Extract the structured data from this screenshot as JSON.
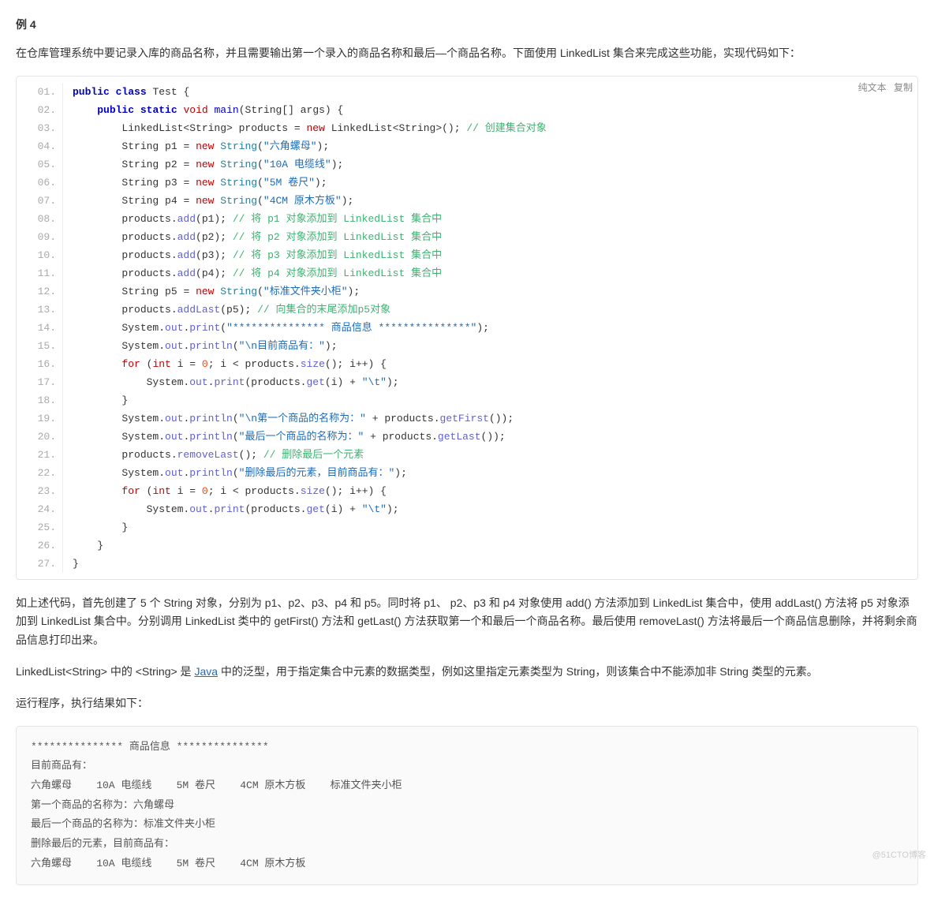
{
  "heading": "例 4",
  "intro": "在仓库管理系统中要记录入库的商品名称，并且需要输出第一个录入的商品名称和最后—个商品名称。下面使用 LinkedList 集合来完成这些功能，实现代码如下：",
  "toolbar": {
    "plain": "纯文本",
    "copy": "复制"
  },
  "code": {
    "lines": [
      [
        {
          "t": "public",
          "c": "kw"
        },
        {
          "t": " "
        },
        {
          "t": "class",
          "c": "kw"
        },
        {
          "t": " Test {"
        }
      ],
      [
        {
          "t": "    "
        },
        {
          "t": "public",
          "c": "kw"
        },
        {
          "t": " "
        },
        {
          "t": "static",
          "c": "kw"
        },
        {
          "t": " "
        },
        {
          "t": "void",
          "c": "kw2"
        },
        {
          "t": " "
        },
        {
          "t": "main",
          "c": "method"
        },
        {
          "t": "(String[] args) {"
        }
      ],
      [
        {
          "t": "        LinkedList<String> products "
        },
        {
          "t": "=",
          "c": "punct"
        },
        {
          "t": " "
        },
        {
          "t": "new",
          "c": "kw2"
        },
        {
          "t": " LinkedList<String>();"
        },
        {
          "t": " "
        },
        {
          "t": "// 创建集合对象",
          "c": "comment"
        }
      ],
      [
        {
          "t": "        String p1 "
        },
        {
          "t": "=",
          "c": "punct"
        },
        {
          "t": " "
        },
        {
          "t": "new",
          "c": "kw2"
        },
        {
          "t": " "
        },
        {
          "t": "String",
          "c": "fn"
        },
        {
          "t": "("
        },
        {
          "t": "\"六角螺母\"",
          "c": "str"
        },
        {
          "t": ");"
        }
      ],
      [
        {
          "t": "        String p2 "
        },
        {
          "t": "=",
          "c": "punct"
        },
        {
          "t": " "
        },
        {
          "t": "new",
          "c": "kw2"
        },
        {
          "t": " "
        },
        {
          "t": "String",
          "c": "fn"
        },
        {
          "t": "("
        },
        {
          "t": "\"10A 电缆线\"",
          "c": "str"
        },
        {
          "t": ");"
        }
      ],
      [
        {
          "t": "        String p3 "
        },
        {
          "t": "=",
          "c": "punct"
        },
        {
          "t": " "
        },
        {
          "t": "new",
          "c": "kw2"
        },
        {
          "t": " "
        },
        {
          "t": "String",
          "c": "fn"
        },
        {
          "t": "("
        },
        {
          "t": "\"5M 卷尺\"",
          "c": "str"
        },
        {
          "t": ");"
        }
      ],
      [
        {
          "t": "        String p4 "
        },
        {
          "t": "=",
          "c": "punct"
        },
        {
          "t": " "
        },
        {
          "t": "new",
          "c": "kw2"
        },
        {
          "t": " "
        },
        {
          "t": "String",
          "c": "fn"
        },
        {
          "t": "("
        },
        {
          "t": "\"4CM 原木方板\"",
          "c": "str"
        },
        {
          "t": ");"
        }
      ],
      [
        {
          "t": "        products."
        },
        {
          "t": "add",
          "c": "methodCall"
        },
        {
          "t": "(p1);"
        },
        {
          "t": " "
        },
        {
          "t": "// 将 p1 对象添加到 LinkedList 集合中",
          "c": "comment"
        }
      ],
      [
        {
          "t": "        products."
        },
        {
          "t": "add",
          "c": "methodCall"
        },
        {
          "t": "(p2);"
        },
        {
          "t": " "
        },
        {
          "t": "// 将 p2 对象添加到 LinkedList 集合中",
          "c": "comment"
        }
      ],
      [
        {
          "t": "        products."
        },
        {
          "t": "add",
          "c": "methodCall"
        },
        {
          "t": "(p3);"
        },
        {
          "t": " "
        },
        {
          "t": "// 将 p3 对象添加到 LinkedList 集合中",
          "c": "comment"
        }
      ],
      [
        {
          "t": "        products."
        },
        {
          "t": "add",
          "c": "methodCall"
        },
        {
          "t": "(p4);"
        },
        {
          "t": " "
        },
        {
          "t": "// 将 p4 对象添加到 LinkedList 集合中",
          "c": "comment"
        }
      ],
      [
        {
          "t": "        String p5 "
        },
        {
          "t": "=",
          "c": "punct"
        },
        {
          "t": " "
        },
        {
          "t": "new",
          "c": "kw2"
        },
        {
          "t": " "
        },
        {
          "t": "String",
          "c": "fn"
        },
        {
          "t": "("
        },
        {
          "t": "\"标准文件夹小柜\"",
          "c": "str"
        },
        {
          "t": ");"
        }
      ],
      [
        {
          "t": "        products."
        },
        {
          "t": "addLast",
          "c": "methodCall"
        },
        {
          "t": "(p5);"
        },
        {
          "t": " "
        },
        {
          "t": "// 向集合的末尾添加p5对象",
          "c": "comment"
        }
      ],
      [
        {
          "t": "        System."
        },
        {
          "t": "out",
          "c": "methodCall"
        },
        {
          "t": "."
        },
        {
          "t": "print",
          "c": "methodCall"
        },
        {
          "t": "("
        },
        {
          "t": "\"*************** 商品信息 ***************\"",
          "c": "str"
        },
        {
          "t": ");"
        }
      ],
      [
        {
          "t": "        System."
        },
        {
          "t": "out",
          "c": "methodCall"
        },
        {
          "t": "."
        },
        {
          "t": "println",
          "c": "methodCall"
        },
        {
          "t": "("
        },
        {
          "t": "\"\\n目前商品有：\"",
          "c": "str"
        },
        {
          "t": ");"
        }
      ],
      [
        {
          "t": "        "
        },
        {
          "t": "for",
          "c": "kw2"
        },
        {
          "t": " ("
        },
        {
          "t": "int",
          "c": "kw2"
        },
        {
          "t": " i "
        },
        {
          "t": "=",
          "c": "punct"
        },
        {
          "t": " "
        },
        {
          "t": "0",
          "c": "num"
        },
        {
          "t": "; i < products."
        },
        {
          "t": "size",
          "c": "methodCall"
        },
        {
          "t": "(); i++) {"
        }
      ],
      [
        {
          "t": "            System."
        },
        {
          "t": "out",
          "c": "methodCall"
        },
        {
          "t": "."
        },
        {
          "t": "print",
          "c": "methodCall"
        },
        {
          "t": "(products."
        },
        {
          "t": "get",
          "c": "methodCall"
        },
        {
          "t": "(i) "
        },
        {
          "t": "+",
          "c": "punct"
        },
        {
          "t": " "
        },
        {
          "t": "\"\\t\"",
          "c": "str"
        },
        {
          "t": ");"
        }
      ],
      [
        {
          "t": "        }"
        }
      ],
      [
        {
          "t": "        System."
        },
        {
          "t": "out",
          "c": "methodCall"
        },
        {
          "t": "."
        },
        {
          "t": "println",
          "c": "methodCall"
        },
        {
          "t": "("
        },
        {
          "t": "\"\\n第一个商品的名称为：\"",
          "c": "str"
        },
        {
          "t": " "
        },
        {
          "t": "+",
          "c": "punct"
        },
        {
          "t": " products."
        },
        {
          "t": "getFirst",
          "c": "methodCall"
        },
        {
          "t": "());"
        }
      ],
      [
        {
          "t": "        System."
        },
        {
          "t": "out",
          "c": "methodCall"
        },
        {
          "t": "."
        },
        {
          "t": "println",
          "c": "methodCall"
        },
        {
          "t": "("
        },
        {
          "t": "\"最后一个商品的名称为：\"",
          "c": "str"
        },
        {
          "t": " "
        },
        {
          "t": "+",
          "c": "punct"
        },
        {
          "t": " products."
        },
        {
          "t": "getLast",
          "c": "methodCall"
        },
        {
          "t": "());"
        }
      ],
      [
        {
          "t": "        products."
        },
        {
          "t": "removeLast",
          "c": "methodCall"
        },
        {
          "t": "();"
        },
        {
          "t": " "
        },
        {
          "t": "// 删除最后一个元素",
          "c": "comment"
        }
      ],
      [
        {
          "t": "        System."
        },
        {
          "t": "out",
          "c": "methodCall"
        },
        {
          "t": "."
        },
        {
          "t": "println",
          "c": "methodCall"
        },
        {
          "t": "("
        },
        {
          "t": "\"删除最后的元素，目前商品有：\"",
          "c": "str"
        },
        {
          "t": ");"
        }
      ],
      [
        {
          "t": "        "
        },
        {
          "t": "for",
          "c": "kw2"
        },
        {
          "t": " ("
        },
        {
          "t": "int",
          "c": "kw2"
        },
        {
          "t": " i "
        },
        {
          "t": "=",
          "c": "punct"
        },
        {
          "t": " "
        },
        {
          "t": "0",
          "c": "num"
        },
        {
          "t": "; i < products."
        },
        {
          "t": "size",
          "c": "methodCall"
        },
        {
          "t": "(); i++) {"
        }
      ],
      [
        {
          "t": "            System."
        },
        {
          "t": "out",
          "c": "methodCall"
        },
        {
          "t": "."
        },
        {
          "t": "print",
          "c": "methodCall"
        },
        {
          "t": "(products."
        },
        {
          "t": "get",
          "c": "methodCall"
        },
        {
          "t": "(i) "
        },
        {
          "t": "+",
          "c": "punct"
        },
        {
          "t": " "
        },
        {
          "t": "\"\\t\"",
          "c": "str"
        },
        {
          "t": ");"
        }
      ],
      [
        {
          "t": "        }"
        }
      ],
      [
        {
          "t": "    }"
        }
      ],
      [
        {
          "t": "}"
        }
      ]
    ]
  },
  "para1": "如上述代码，首先创建了 5 个 String 对象，分别为 p1、p2、p3、p4 和 p5。同时将 p1、 p2、p3 和 p4 对象使用 add() 方法添加到 LinkedList 集合中，使用 addLast() 方法将 p5 对象添加到 LinkedList 集合中。分别调用 LinkedList 类中的 getFirst() 方法和 getLast() 方法获取第一个和最后一个商品名称。最后使用 removeLast() 方法将最后一个商品信息删除，并将剩余商品信息打印出来。",
  "para2_pre": "LinkedList<String> 中的 <String> 是 ",
  "para2_link": "Java",
  "para2_post": " 中的泛型，用于指定集合中元素的数据类型，例如这里指定元素类型为 String，则该集合中不能添加非 String 类型的元素。",
  "para3": "运行程序，执行结果如下：",
  "output": "*************** 商品信息 ***************\n目前商品有：\n六角螺母    10A 电缆线    5M 卷尺    4CM 原木方板    标准文件夹小柜   \n第一个商品的名称为：六角螺母\n最后一个商品的名称为：标准文件夹小柜\n删除最后的元素，目前商品有：\n六角螺母    10A 电缆线    5M 卷尺    4CM 原木方板",
  "watermark": "@51CTO博客"
}
